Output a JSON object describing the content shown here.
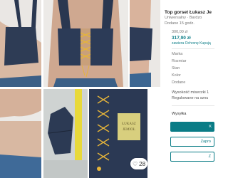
{
  "listing": {
    "title": "Top gorset Łukasz Je",
    "brand_line": "Uniwersalny · Bardzo",
    "added": "Dodane 15 godz.",
    "price_original": "300,00 zł",
    "price_with_protection": "317,90 zł",
    "protection_note": "zawiera Ochronę Kupują"
  },
  "attributes": [
    {
      "label": "Marka"
    },
    {
      "label": "Rozmiar"
    },
    {
      "label": "Stan"
    },
    {
      "label": "Kolor"
    },
    {
      "label": "Dodane"
    }
  ],
  "shipping": {
    "line1": "Wysokość miseczki 1",
    "line2": "Regulowane na sznu",
    "label": "Wysyłka"
  },
  "buttons": {
    "primary": "K",
    "secondary": "Zapro",
    "tertiary": "Z"
  },
  "gallery": {
    "likes": "28"
  }
}
